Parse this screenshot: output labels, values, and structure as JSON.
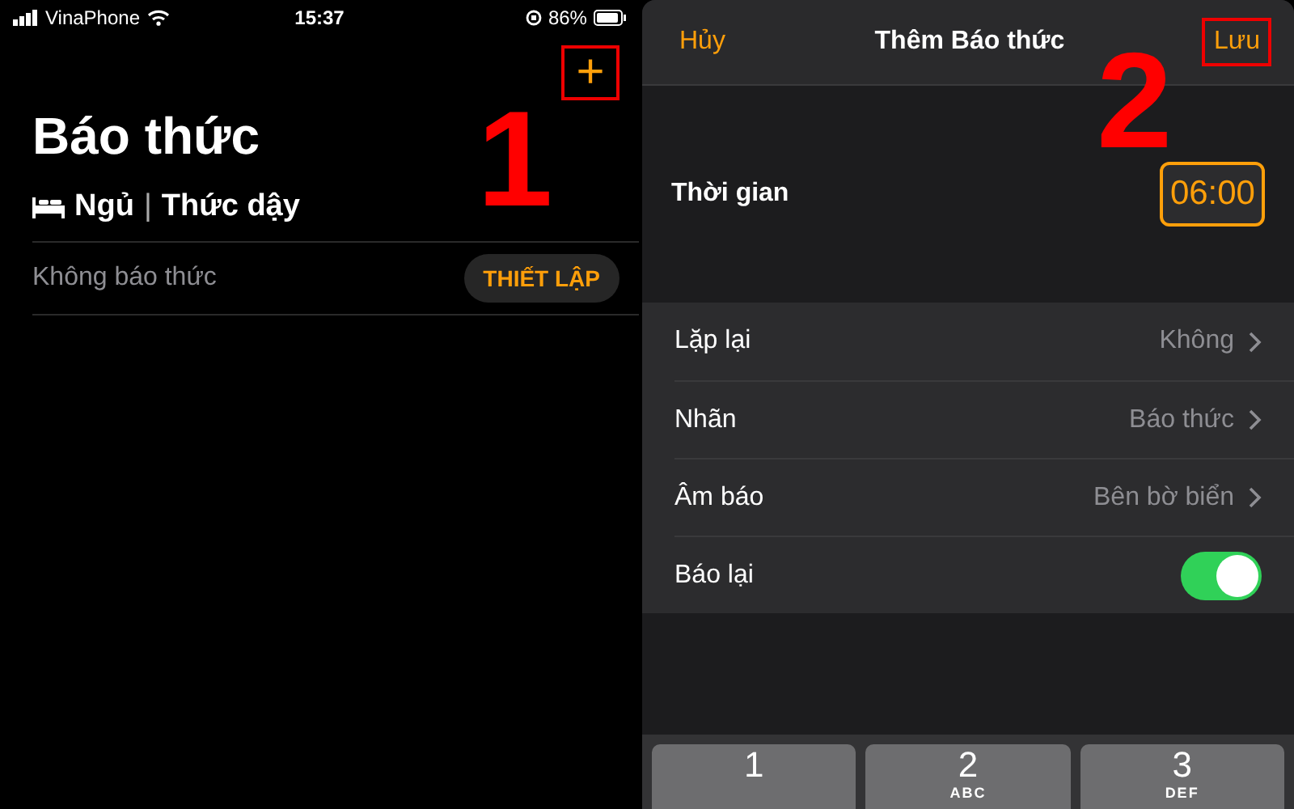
{
  "left_screen": {
    "status_bar": {
      "carrier": "VinaPhone",
      "time": "15:37",
      "battery": "86%"
    },
    "add_button": {
      "label": "+",
      "highlighted": true
    },
    "title": "Báo thức",
    "sleep_row": {
      "sleep": "Ngủ",
      "separator": "|",
      "wake": "Thức dậy"
    },
    "alarm_row": {
      "text": "Không báo thức",
      "button": "THIẾT LẬP"
    }
  },
  "right_screen": {
    "header": {
      "cancel": "Hủy",
      "title": "Thêm Báo thức",
      "save": "Lưu",
      "save_highlighted": true
    },
    "time_row": {
      "label": "Thời gian",
      "value": "06:00"
    },
    "settings": [
      {
        "kind": "link",
        "label": "Lặp lại",
        "value": "Không"
      },
      {
        "kind": "link",
        "label": "Nhãn",
        "value": "Báo thức"
      },
      {
        "kind": "link",
        "label": "Âm báo",
        "value": "Bên bờ biển"
      },
      {
        "kind": "toggle",
        "label": "Báo lại",
        "on": true
      }
    ],
    "keypad": [
      {
        "digit": "1"
      },
      {
        "digit": "2",
        "letters": "ABC"
      },
      {
        "digit": "3",
        "letters": "DEF"
      }
    ]
  },
  "annotations": [
    {
      "label": "1"
    },
    {
      "label": "2"
    }
  ]
}
